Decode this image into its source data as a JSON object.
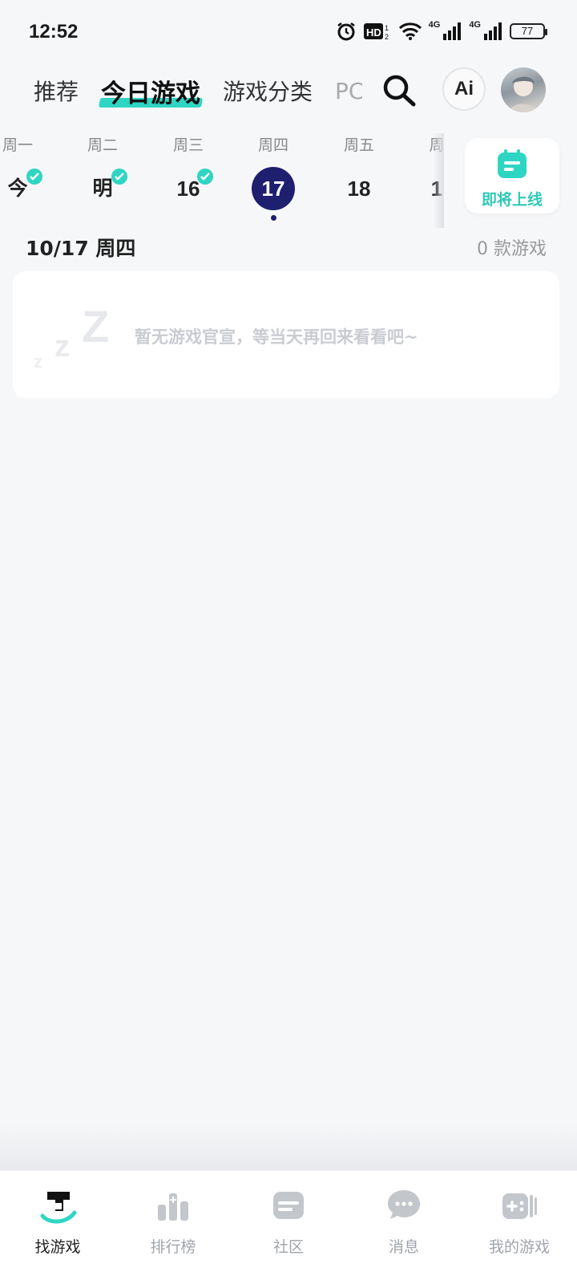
{
  "status_bar": {
    "time": "12:52",
    "battery": "77",
    "icons": [
      "alarm-icon",
      "hd-icon",
      "wifi-icon",
      "4g-signal-icon",
      "4g-signal-icon",
      "battery-icon"
    ],
    "net_labels": [
      "4G",
      "4G"
    ]
  },
  "top_tabs": [
    {
      "label": "推荐",
      "active": false
    },
    {
      "label": "今日游戏",
      "active": true
    },
    {
      "label": "游戏分类",
      "active": false
    },
    {
      "label": "PC",
      "active": false
    }
  ],
  "header_actions": {
    "search_icon": "search-icon",
    "ai_label": "Ai",
    "avatar": "user-avatar"
  },
  "date_strip": {
    "days": [
      {
        "weekday": "周一",
        "label": "今",
        "checked": true,
        "selected": false
      },
      {
        "weekday": "周二",
        "label": "明",
        "checked": true,
        "selected": false
      },
      {
        "weekday": "周三",
        "label": "16",
        "checked": true,
        "selected": false
      },
      {
        "weekday": "周四",
        "label": "17",
        "checked": false,
        "selected": true
      },
      {
        "weekday": "周五",
        "label": "18",
        "checked": false,
        "selected": false
      },
      {
        "weekday": "周",
        "label": "1",
        "checked": false,
        "selected": false
      }
    ],
    "upcoming_label": "即将上线"
  },
  "date_header": {
    "title": "10/17 周四",
    "count": "0 款游戏"
  },
  "empty_state": {
    "message": "暂无游戏官宣，等当天再回来看看吧~"
  },
  "bottom_nav": [
    {
      "label": "找游戏",
      "icon": "find-games-icon",
      "active": true
    },
    {
      "label": "排行榜",
      "icon": "ranking-icon",
      "active": false
    },
    {
      "label": "社区",
      "icon": "community-icon",
      "active": false
    },
    {
      "label": "消息",
      "icon": "message-icon",
      "active": false
    },
    {
      "label": "我的游戏",
      "icon": "my-games-icon",
      "active": false
    }
  ],
  "colors": {
    "accent": "#2fd5c3",
    "selected_day": "#1e1f6e",
    "background": "#f6f7f9"
  }
}
